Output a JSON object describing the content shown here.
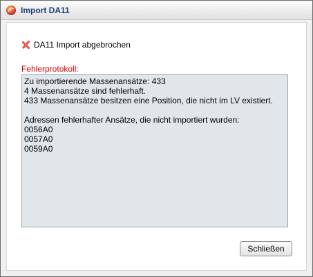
{
  "window": {
    "title": "Import DA11",
    "app_icon": "app-logo-icon"
  },
  "status": {
    "icon": "error-x-icon",
    "text": "DA11 Import abgebrochen"
  },
  "log": {
    "label": "Fehlerprotokoll:",
    "lines": [
      "Zu importierende Massenansätze: 433",
      "4 Massenansätze sind fehlerhaft.",
      "433 Massenansätze besitzen eine Position, die nicht im LV existiert.",
      "",
      "Adressen fehlerhafter Ansätze, die nicht importiert wurden:",
      "0056A0",
      "0057A0",
      "0059A0"
    ]
  },
  "buttons": {
    "close_label": "Schließen"
  },
  "colors": {
    "title_text": "#1e3f7a",
    "log_label": "#d40000",
    "log_background": "#e0e6ea",
    "error_icon": "#d63a2c"
  }
}
